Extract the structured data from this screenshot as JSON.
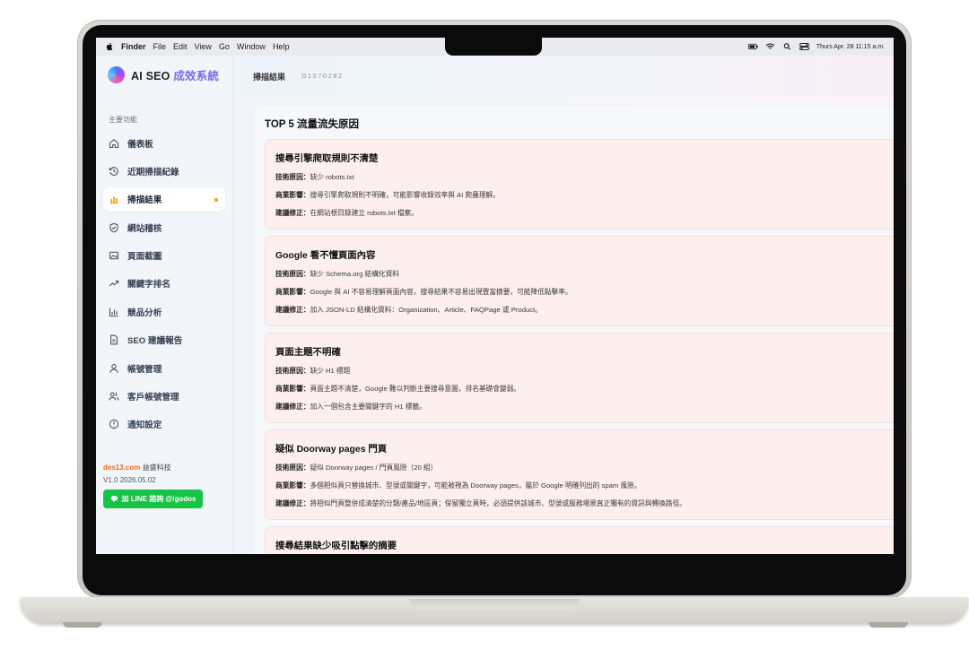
{
  "menubar": {
    "items": [
      "Finder",
      "File",
      "Edit",
      "View",
      "Go",
      "Window",
      "Help"
    ],
    "clock": "Thurs Apr. 28 11:15 a.m."
  },
  "brand": {
    "name": "AI SEO",
    "sub": "成效系統"
  },
  "sidebar": {
    "section": "主要功能",
    "items": [
      {
        "label": "儀表板",
        "icon": "home-icon"
      },
      {
        "label": "近期掃描紀錄",
        "icon": "history-icon"
      },
      {
        "label": "掃描結果",
        "icon": "bar-chart-icon"
      },
      {
        "label": "網站稽核",
        "icon": "shield-icon"
      },
      {
        "label": "頁面截圖",
        "icon": "image-icon"
      },
      {
        "label": "關鍵字排名",
        "icon": "trending-up-icon"
      },
      {
        "label": "競品分析",
        "icon": "chart-icon"
      },
      {
        "label": "SEO 建議報告",
        "icon": "document-icon"
      },
      {
        "label": "帳號管理",
        "icon": "user-icon"
      },
      {
        "label": "客戶帳號管理",
        "icon": "users-icon"
      },
      {
        "label": "通知設定",
        "icon": "bell-icon"
      }
    ],
    "company_domain": "des13.com",
    "company_name": "益盛科技",
    "version": "V1.0",
    "date": "2026.05.02",
    "line_button": "加 LINE 諮詢 @igodos"
  },
  "topbar": {
    "title": "掃描結果",
    "id": "D1570282"
  },
  "panel": {
    "title": "TOP 5 流量流失原因",
    "labels": {
      "tech": "技術原因：",
      "impact": "商業影響：",
      "fix": "建議修正："
    },
    "cards": [
      {
        "title": "搜尋引擎爬取規則不清楚",
        "tech": "缺少 robots.txt",
        "impact": "搜尋引擎爬取規則不明確，可能影響收錄效率與 AI 爬蟲理解。",
        "fix": "在網站根目錄建立 robots.txt 檔案。"
      },
      {
        "title": "Google 看不懂頁面內容",
        "tech": "缺少 Schema.org 結構化資料",
        "impact": "Google 與 AI 不容易理解頁面內容，搜尋結果不容易出現豐富摘要，可能降低點擊率。",
        "fix": "加入 JSON-LD 結構化資料：Organization、Article、FAQPage 或 Product。"
      },
      {
        "title": "頁面主題不明確",
        "tech": "缺少 H1 標題",
        "impact": "頁面主題不清楚，Google 難以判斷主要搜尋意圖，排名基礎會變弱。",
        "fix": "加入一個包含主要關鍵字的 H1 標籤。"
      },
      {
        "title": "疑似 Doorway pages 門頁",
        "tech": "疑似 Doorway pages / 門頁風險（20 組）",
        "impact": "多個相似頁只替換城市、型號或關鍵字，可能被視為 Doorway pages，屬於 Google 明確列出的 spam 風險。",
        "fix": "將相似門頁整併成清楚的分類/產品/地區頁；保留獨立頁時，必須提供該城市、型號或服務場景真正獨有的資訊與轉換路徑。"
      },
      {
        "title": "搜尋結果缺少吸引點擊的摘要",
        "tech": "",
        "impact": "",
        "fix": ""
      }
    ]
  }
}
